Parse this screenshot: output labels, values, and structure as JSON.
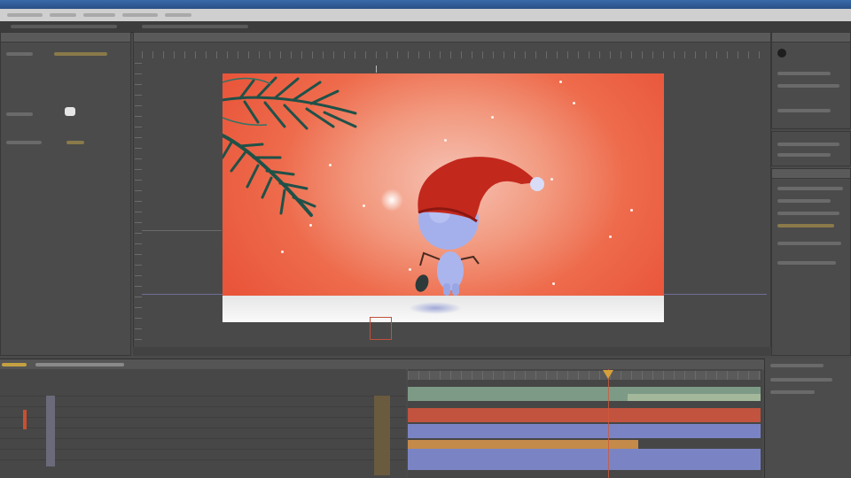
{
  "app": {
    "window_title": ""
  },
  "colors": {
    "background": "#4a4a4a",
    "composition_red": "#e9553a",
    "snow": "#f5f5f5",
    "hat_red": "#c3281d",
    "body_blue": "#a8b4ee",
    "tree_green": "#1f5148",
    "timeline_green": "#7d9a86",
    "timeline_red": "#c1533f",
    "timeline_blue": "#7a84c4",
    "timeline_orange": "#c48a4a",
    "playhead": "#d05a3a"
  },
  "icons": {
    "snowman": "snowman-character-icon",
    "tree": "pine-branch-icon"
  },
  "timeline": {
    "layers": [
      {
        "color": "#7d9a86"
      },
      {
        "color": "#c1533f"
      },
      {
        "color": "#7a84c4"
      },
      {
        "color": "#c48a4a"
      },
      {
        "color": "#7a84c4"
      }
    ]
  }
}
